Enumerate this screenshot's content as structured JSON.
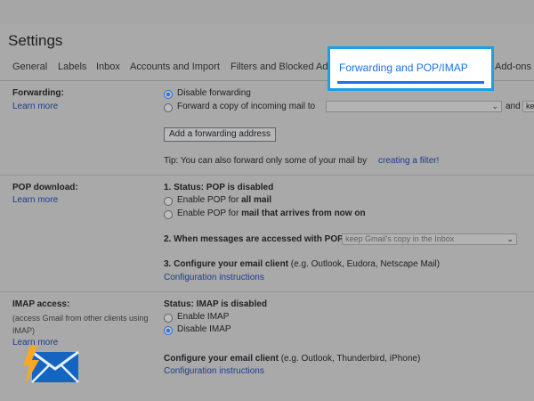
{
  "header": {
    "title": "Settings"
  },
  "tabs": [
    {
      "label": "General"
    },
    {
      "label": "Labels"
    },
    {
      "label": "Inbox"
    },
    {
      "label": "Accounts and Import"
    },
    {
      "label": "Filters and Blocked Ad"
    },
    {
      "label": "Forwarding and POP/IMAP"
    },
    {
      "label": "Add-ons"
    }
  ],
  "forwarding": {
    "label": "Forwarding:",
    "learn_more": "Learn more",
    "option_disable": "Disable forwarding",
    "option_forward": "Forward a copy of incoming mail to",
    "and_text": "and",
    "tail_text": "ke",
    "add_button": "Add a forwarding address",
    "tip_text": "Tip: You can also forward only some of your mail by",
    "tip_link": "creating a filter!"
  },
  "pop": {
    "label": "POP download:",
    "learn_more": "Learn more",
    "status": "1. Status: POP is disabled",
    "option_all_prefix": "Enable POP for ",
    "option_all_bold": "all mail",
    "option_now_prefix": "Enable POP for ",
    "option_now_bold": "mail that arrives from now on",
    "accessed_label": "2. When messages are accessed with POP",
    "accessed_select": "keep Gmail's copy in the Inbox",
    "configure_bold": "3. Configure your email client",
    "configure_rest": " (e.g. Outlook, Eudora, Netscape Mail)",
    "config_link": "Configuration instructions"
  },
  "imap": {
    "label": "IMAP access:",
    "sub_line1": "(access Gmail from other clients using",
    "sub_line2": "IMAP)",
    "learn_more": "Learn more",
    "status": "Status: IMAP is disabled",
    "option_enable": "Enable IMAP",
    "option_disable": "Disable IMAP",
    "configure_bold": "Configure your email client",
    "configure_rest": " (e.g. Outlook, Thunderbird, iPhone)",
    "config_link": "Configuration instructions"
  },
  "colors": {
    "accent": "#1a73e8",
    "highlight_border": "#1a9fe0",
    "link": "#1a3c8c"
  }
}
